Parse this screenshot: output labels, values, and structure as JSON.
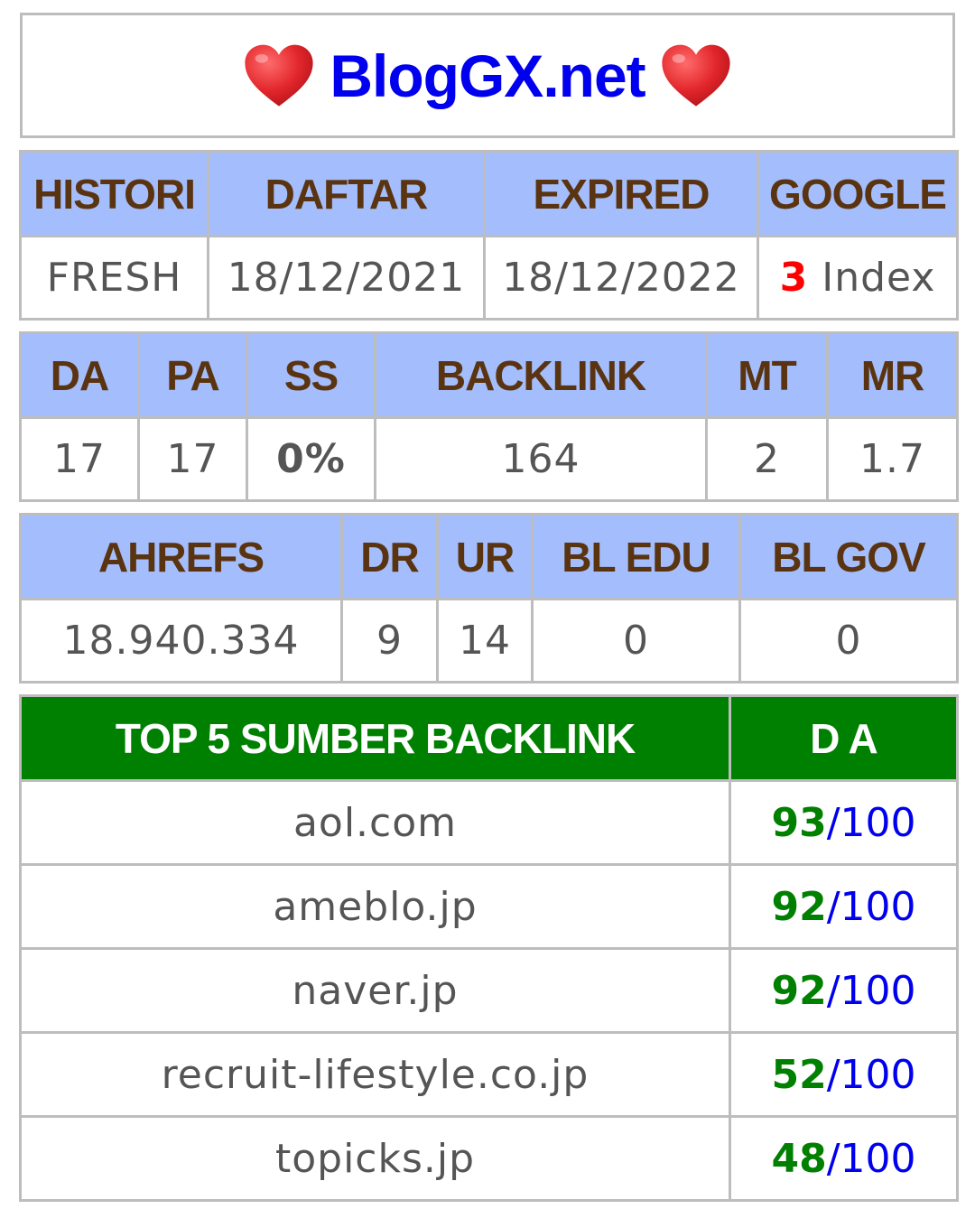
{
  "header": {
    "title": "BlogGX.net",
    "left_icon": "heart-icon",
    "right_icon": "heart-icon",
    "title_color": "#0000ee"
  },
  "table1": {
    "headers": [
      "HISTORI",
      "DAFTAR",
      "EXPIRED",
      "GOOGLE"
    ],
    "histori": "FRESH",
    "daftar": "18/12/2021",
    "expired": "18/12/2022",
    "google_count": "3",
    "google_suffix": " Index"
  },
  "table2": {
    "headers": [
      "DA",
      "PA",
      "SS",
      "BACKLINK",
      "MT",
      "MR"
    ],
    "values": [
      "17",
      "17",
      "0%",
      "164",
      "2",
      "1.7"
    ]
  },
  "table3": {
    "headers": [
      "AHREFS",
      "DR",
      "UR",
      "BL EDU",
      "BL GOV"
    ],
    "values": [
      "18.940.334",
      "9",
      "14",
      "0",
      "0"
    ]
  },
  "top_backlinks": {
    "header_site": "TOP 5 SUMBER BACKLINK",
    "header_da": "D A",
    "da_max": "/100",
    "rows": [
      {
        "site": "aol.com",
        "da": "93"
      },
      {
        "site": "ameblo.jp",
        "da": "92"
      },
      {
        "site": "naver.jp",
        "da": "92"
      },
      {
        "site": "recruit-lifestyle.co.jp",
        "da": "52"
      },
      {
        "site": "topicks.jp",
        "da": "48"
      }
    ]
  },
  "colors": {
    "header_bg": "#a4bdfc",
    "header_text": "#5a3411",
    "top_header_bg": "#008000",
    "border": "#bdbdbd",
    "index_count": "#ff0000",
    "ss_value": "#7cd000"
  }
}
